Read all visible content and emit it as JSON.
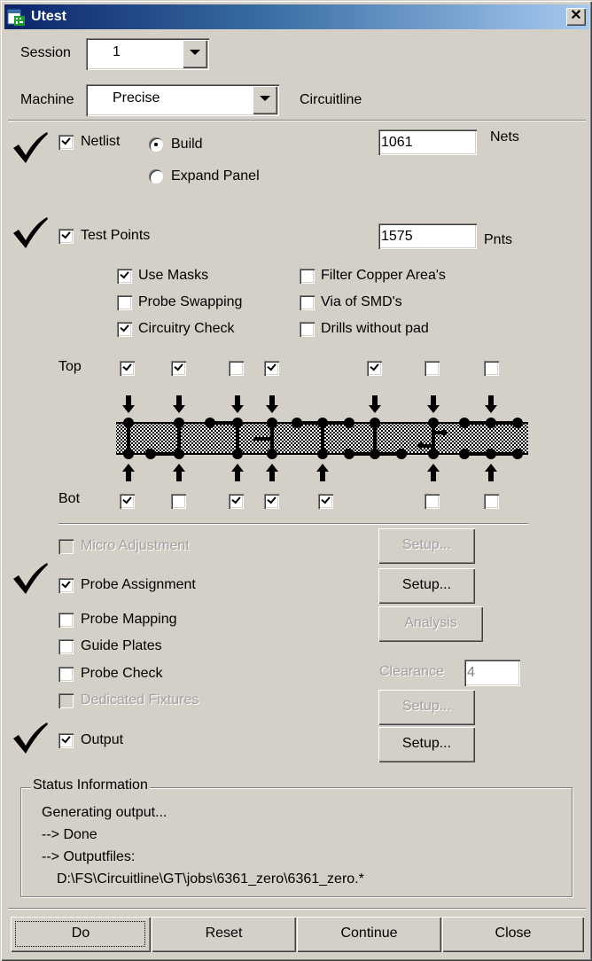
{
  "window": {
    "title": "Utest",
    "icon": "app-icon",
    "close_icon": "close-icon"
  },
  "header": {
    "session_label": "Session",
    "session_value": "1",
    "machine_label": "Machine",
    "machine_value": "Precise",
    "machine_info": "Circuitline"
  },
  "netlist": {
    "done": true,
    "label": "Netlist",
    "checked": true,
    "radio_build": "Build",
    "radio_expand": "Expand Panel",
    "selected": "Build",
    "count": "1061",
    "unit": "Nets"
  },
  "testpoints": {
    "done": true,
    "label": "Test Points",
    "checked": true,
    "count": "1575",
    "unit": "Pnts",
    "options": [
      {
        "label": "Use Masks",
        "checked": true
      },
      {
        "label": "Probe Swapping",
        "checked": false
      },
      {
        "label": "Circuitry Check",
        "checked": true
      },
      {
        "label": "Filter Copper Area's",
        "checked": false
      },
      {
        "label": "Via of SMD's",
        "checked": false
      },
      {
        "label": "Drills without pad",
        "checked": false
      }
    ],
    "top_label": "Top",
    "bot_label": "Bot",
    "top_checks": [
      true,
      true,
      false,
      true,
      true,
      false,
      false
    ],
    "bot_checks": [
      true,
      false,
      true,
      true,
      true,
      false,
      false
    ]
  },
  "steps": {
    "micro_adjustment": {
      "label": "Micro Adjustment",
      "checked": false,
      "enabled": false,
      "button": "Setup..."
    },
    "probe_assignment": {
      "label": "Probe Assignment",
      "checked": true,
      "done": true,
      "button": "Setup..."
    },
    "probe_mapping": {
      "label": "Probe Mapping",
      "checked": false,
      "button": "Analysis"
    },
    "guide_plates": {
      "label": "Guide Plates",
      "checked": false
    },
    "probe_check": {
      "label": "Probe Check",
      "checked": false,
      "clearance_label": "Clearance",
      "clearance_value": "4"
    },
    "dedicated_fixtures": {
      "label": "Dedicated Fixtures",
      "checked": false,
      "enabled": false,
      "button": "Setup..."
    },
    "output": {
      "label": "Output",
      "checked": true,
      "done": true,
      "button": "Setup..."
    }
  },
  "status": {
    "title": "Status Information",
    "lines": [
      "Generating output...",
      "--> Done",
      "--> Outputfiles:",
      "D:\\FS\\Circuitline\\GT\\jobs\\6361_zero\\6361_zero.*"
    ]
  },
  "footer": {
    "do": "Do",
    "reset": "Reset",
    "continue": "Continue",
    "close": "Close"
  }
}
